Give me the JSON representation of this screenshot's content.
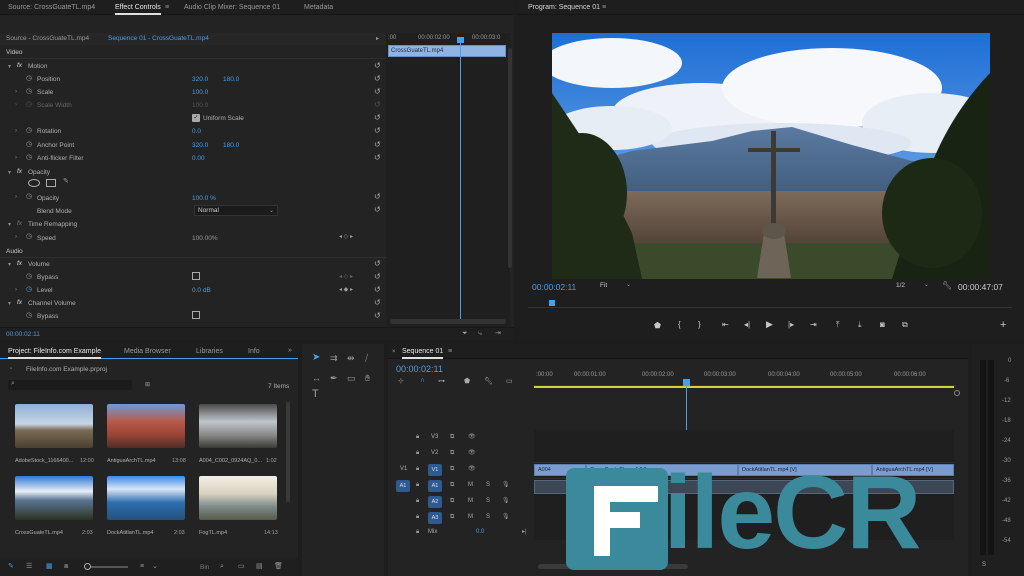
{
  "effect_controls": {
    "tabs": [
      "Source: CrossGuateTL.mp4",
      "Effect Controls",
      "Audio Clip Mixer: Sequence 01",
      "Metadata"
    ],
    "subtabs": [
      "Source - CrossGuateTL.mp4",
      "Sequence 01 - CrossGuateTL.mp4"
    ],
    "mini_times": [
      ":00",
      "00:00:02:00",
      "00:00:03:0"
    ],
    "clip_label": "CrossGuateTL.mp4",
    "video_header": "Video",
    "motion": "Motion",
    "position": {
      "label": "Position",
      "x": "320.0",
      "y": "180.0"
    },
    "scale": {
      "label": "Scale",
      "value": "100.0"
    },
    "scale_width": {
      "label": "Scale Width",
      "value": "100.0"
    },
    "uniform_scale": "Uniform Scale",
    "rotation": {
      "label": "Rotation",
      "value": "0.0"
    },
    "anchor": {
      "label": "Anchor Point",
      "x": "320.0",
      "y": "180.0"
    },
    "flicker": {
      "label": "Anti-flicker Filter",
      "value": "0.00"
    },
    "opacity_group": "Opacity",
    "opacity": {
      "label": "Opacity",
      "value": "100.0 %"
    },
    "blend": {
      "label": "Blend Mode",
      "value": "Normal"
    },
    "time_remap": "Time Remapping",
    "speed": {
      "label": "Speed",
      "value": "100.00%"
    },
    "audio_header": "Audio",
    "volume": "Volume",
    "bypass": "Bypass",
    "level": {
      "label": "Level",
      "value": "0.0 dB"
    },
    "channel_volume": "Channel Volume",
    "bypass2": "Bypass",
    "timecode": "00:00:02:11"
  },
  "program": {
    "title": "Program: Sequence 01",
    "timecode": "00:00:02:11",
    "fit": "Fit",
    "ratio": "1/2",
    "duration": "00:00:47:07"
  },
  "project": {
    "tabs": [
      "Project: FileInfo.com Example",
      "Media Browser",
      "Libraries",
      "Info"
    ],
    "file": "FileInfo.com Example.prproj",
    "count": "7 Items",
    "bin": "Bin",
    "items": [
      {
        "name": "AdobeStock_1166400...",
        "dur": "12:00"
      },
      {
        "name": "AntiguaArchTL.mp4",
        "dur": "13:08"
      },
      {
        "name": "A004_C002_0924AQ_0...",
        "dur": "1:02"
      },
      {
        "name": "CrossGuateTL.mp4",
        "dur": "2:03"
      },
      {
        "name": "DockAtitlanTL.mp4",
        "dur": "2:03"
      },
      {
        "name": "FogTL.mp4",
        "dur": "14:13"
      }
    ]
  },
  "timeline": {
    "title": "Sequence 01",
    "timecode": "00:00:02:11",
    "ruler": [
      ":00:00",
      "00:00:01:00",
      "00:00:02:00",
      "00:00:03:00",
      "00:00:04:00",
      "00:00:05:00",
      "00:00:06:00"
    ],
    "tracks": [
      "V3",
      "V2",
      "V1",
      "A1",
      "A2",
      "A3"
    ],
    "src_v": "V1",
    "src_a": "A1",
    "mix": "Mix",
    "mix_val": "0.0",
    "clips": [
      "A004",
      "CrossGuateTL.mp4 [V]",
      "DockAtitlanTL.mp4 [V]",
      "AntiguaArchTL.mp4 [V]"
    ],
    "m": "M",
    "s": "S"
  },
  "meters": [
    "0",
    "-6",
    "-12",
    "-18",
    "-24",
    "-30",
    "-36",
    "-42",
    "-48",
    "-54"
  ],
  "meter_solo": "S",
  "watermark": "FileCR",
  "colors": {
    "accent": "#4a9fe6",
    "clip": "#7a9ccf",
    "playhead": "#4a9fe6"
  }
}
